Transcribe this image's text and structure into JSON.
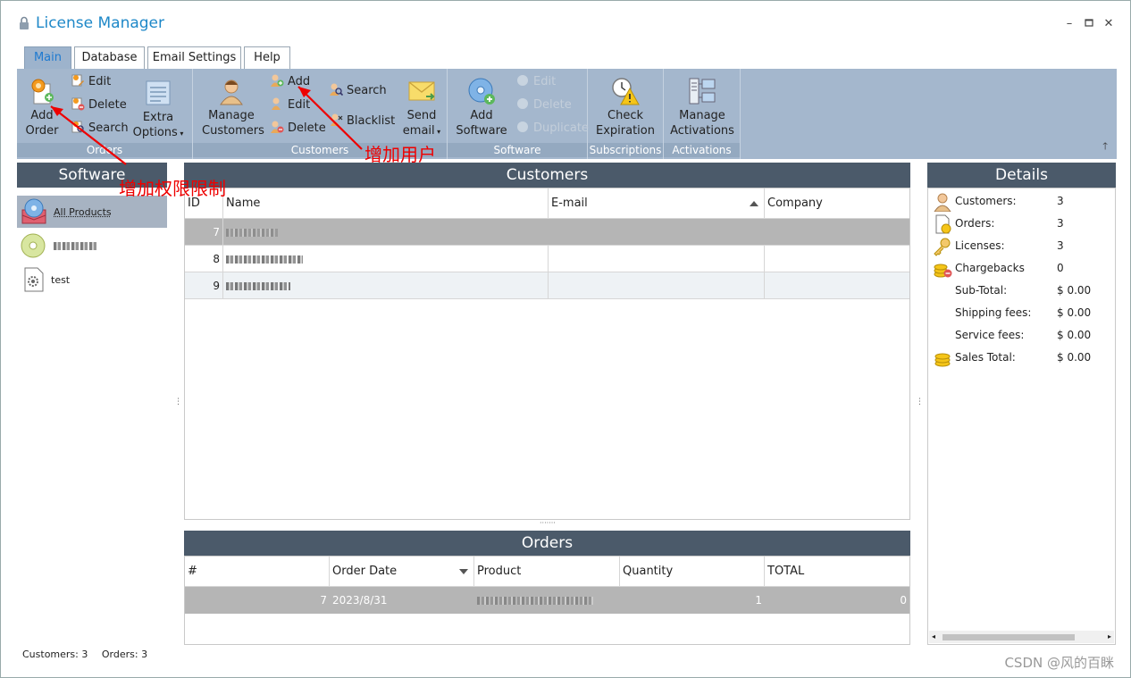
{
  "window": {
    "title": "License Manager",
    "controls": [
      "minimize",
      "maximize",
      "close"
    ]
  },
  "tabs": [
    {
      "label": "Main",
      "active": true
    },
    {
      "label": "Database",
      "active": false
    },
    {
      "label": "Email Settings",
      "active": false
    },
    {
      "label": "Help",
      "active": false
    }
  ],
  "ribbon": {
    "orders": {
      "group_label": "Orders",
      "add": "Add\nOrder",
      "edit": "Edit",
      "delete": "Delete",
      "search": "Search",
      "extra": "Extra\nOptions"
    },
    "customers": {
      "group_label": "Customers",
      "manage": "Manage\nCustomers",
      "add": "Add",
      "edit": "Edit",
      "delete": "Delete",
      "search": "Search",
      "blacklist": "Blacklist",
      "send_email": "Send\nemail"
    },
    "software": {
      "group_label": "Software",
      "add": "Add\nSoftware",
      "edit": "Edit",
      "delete": "Delete",
      "duplicate": "Duplicate"
    },
    "subscriptions": {
      "group_label": "Subscriptions",
      "check": "Check\nExpiration"
    },
    "activations": {
      "group_label": "Activations",
      "manage": "Manage\nActivations"
    }
  },
  "software_panel": {
    "header": "Software",
    "items": [
      {
        "label": "All Products",
        "selected": true
      },
      {
        "label": "",
        "selected": false
      },
      {
        "label": "test",
        "selected": false
      }
    ]
  },
  "customers_panel": {
    "header": "Customers",
    "columns": [
      "ID",
      "Name",
      "E-mail",
      "Company"
    ],
    "rows": [
      {
        "id": "7",
        "selected": true
      },
      {
        "id": "8",
        "selected": false
      },
      {
        "id": "9",
        "selected": false
      }
    ]
  },
  "orders_panel": {
    "header": "Orders",
    "columns": [
      "#",
      "Order Date",
      "Product",
      "Quantity",
      "TOTAL"
    ],
    "rows": [
      {
        "num": "7",
        "date": "2023/8/31",
        "quantity": "1",
        "total": "0"
      }
    ]
  },
  "details_panel": {
    "header": "Details",
    "rows": [
      {
        "label": "Customers:",
        "value": "3",
        "icon": "customers-icon"
      },
      {
        "label": "Orders:",
        "value": "3",
        "icon": "orders-icon"
      },
      {
        "label": "Licenses:",
        "value": "3",
        "icon": "key-icon"
      },
      {
        "label": "Chargebacks",
        "value": "0",
        "icon": "coins-minus-icon"
      },
      {
        "label": "Sub-Total:",
        "value": "$ 0.00",
        "icon": ""
      },
      {
        "label": "Shipping fees:",
        "value": "$ 0.00",
        "icon": ""
      },
      {
        "label": "Service fees:",
        "value": "$ 0.00",
        "icon": ""
      },
      {
        "label": "Sales Total:",
        "value": "$ 0.00",
        "icon": "coins-icon"
      }
    ]
  },
  "status": {
    "customers": "Customers: 3",
    "orders": "Orders: 3"
  },
  "annotations": {
    "permission": "增加权限限制",
    "user": "增加用户"
  },
  "watermark": "CSDN @风的百眯",
  "colors": {
    "ribbon": "#a4b7cd",
    "panel_header": "#4b5a6a",
    "accent": "#1e88c8",
    "annotation": "#ee0000",
    "selected_row": "#b5b5b5"
  }
}
